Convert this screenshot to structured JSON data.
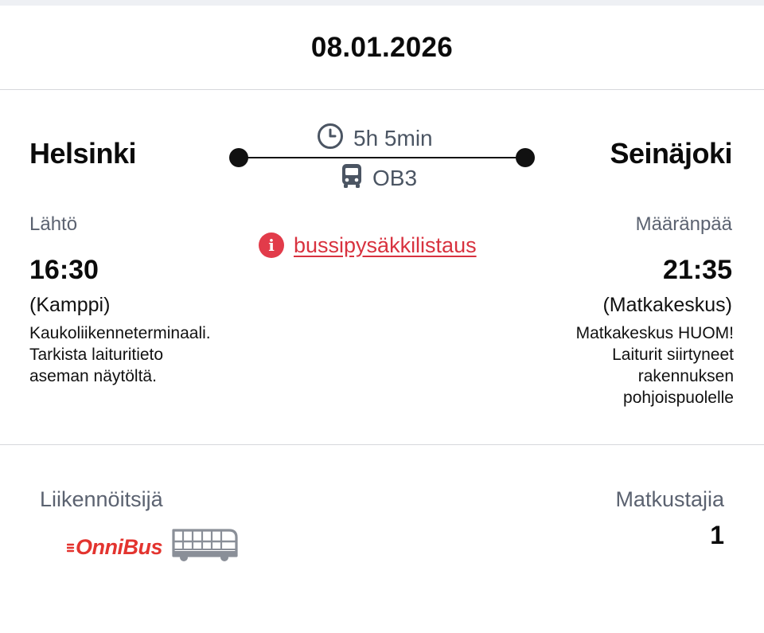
{
  "date": "08.01.2026",
  "route": {
    "from_city": "Helsinki",
    "to_city": "Seinäjoki",
    "duration": "5h 5min",
    "line": "OB3"
  },
  "departure": {
    "label": "Lähtö",
    "time": "16:30",
    "station": "(Kamppi)",
    "note_lines": [
      "Kaukoliikenneterminaali.",
      "Tarkista laituritieto",
      "aseman näytöltä."
    ]
  },
  "arrival": {
    "label": "Määränpää",
    "time": "21:35",
    "station": "(Matkakeskus)",
    "note_lines": [
      "Matkakeskus HUOM!",
      "Laiturit siirtyneet",
      "rakennuksen",
      "pohjoispuolelle"
    ]
  },
  "stop_list_link": "bussipysäkkilistaus",
  "operator": {
    "label": "Liikennöitsijä",
    "logo_text": "OnniBus"
  },
  "passengers": {
    "label": "Matkustajia",
    "count": "1"
  },
  "colors": {
    "accent_red": "#e23b4a",
    "text_dark": "#0b0b0b",
    "text_muted": "#5b6270"
  },
  "icons": {
    "duration": "clock-icon",
    "line": "bus-icon",
    "alert": "info-icon",
    "operator": "double-decker-bus-icon"
  }
}
